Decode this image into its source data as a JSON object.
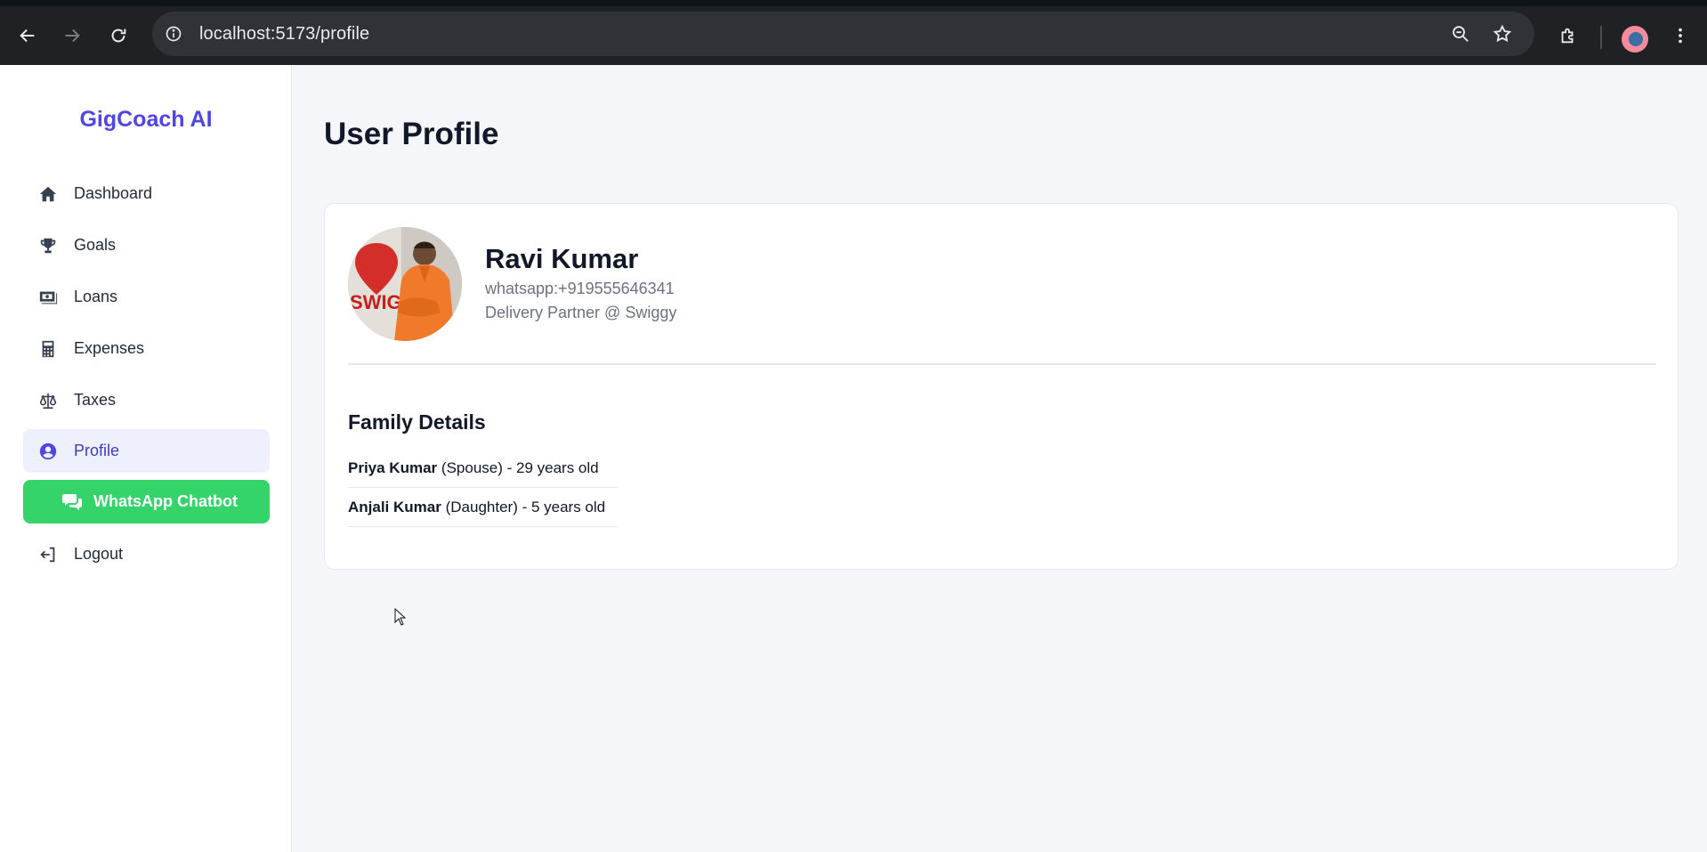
{
  "browser": {
    "url": "localhost:5173/profile"
  },
  "sidebar": {
    "brand": "GigCoach AI",
    "items": [
      {
        "label": "Dashboard",
        "icon": "home-icon"
      },
      {
        "label": "Goals",
        "icon": "trophy-icon"
      },
      {
        "label": "Loans",
        "icon": "money-bill-icon"
      },
      {
        "label": "Expenses",
        "icon": "calculator-icon"
      },
      {
        "label": "Taxes",
        "icon": "scale-icon"
      },
      {
        "label": "Profile",
        "icon": "user-circle-icon",
        "active": true
      }
    ],
    "whatsapp_label": "WhatsApp Chatbot",
    "logout_label": "Logout"
  },
  "main": {
    "title": "User Profile",
    "profile": {
      "name": "Ravi Kumar",
      "phone": "whatsapp:+919555646341",
      "role": "Delivery Partner @ Swiggy"
    },
    "family": {
      "title": "Family Details",
      "members": [
        {
          "name": "Priya Kumar",
          "detail": "(Spouse) - 29 years old"
        },
        {
          "name": "Anjali Kumar",
          "detail": "(Daughter) - 5 years old"
        }
      ]
    }
  },
  "colors": {
    "accent": "#4f46e5",
    "whatsapp": "#35d46a",
    "active_bg": "#eef0fe"
  }
}
